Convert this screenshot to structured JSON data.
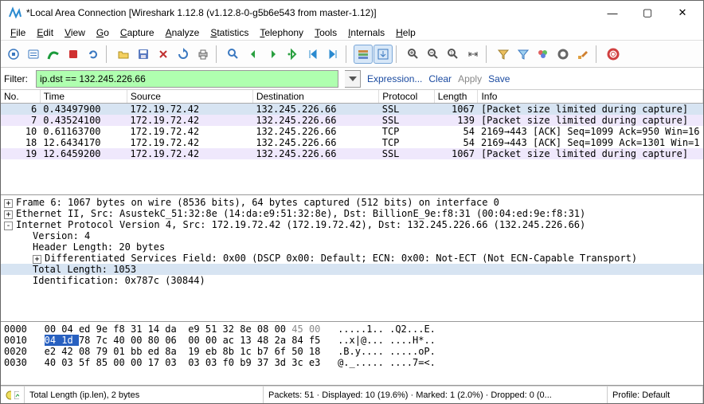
{
  "window": {
    "title": "*Local Area Connection   [Wireshark 1.12.8  (v1.12.8-0-g5b6e543 from master-1.12)]",
    "min": "—",
    "max": "▢",
    "close": "✕"
  },
  "menus": [
    "File",
    "Edit",
    "View",
    "Go",
    "Capture",
    "Analyze",
    "Statistics",
    "Telephony",
    "Tools",
    "Internals",
    "Help"
  ],
  "filter": {
    "label": "Filter:",
    "value": "ip.dst == 132.245.226.66",
    "links": {
      "expression": "Expression...",
      "clear": "Clear",
      "apply": "Apply",
      "save": "Save"
    }
  },
  "columns": [
    "No.",
    "Time",
    "Source",
    "Destination",
    "Protocol",
    "Length",
    "Info"
  ],
  "packets": [
    {
      "no": "6",
      "time": "0.43497900",
      "src": "172.19.72.42",
      "dst": "132.245.226.66",
      "proto": "SSL",
      "len": "1067",
      "info": "[Packet size limited during capture]",
      "sel": true
    },
    {
      "no": "7",
      "time": "0.43524100",
      "src": "172.19.72.42",
      "dst": "132.245.226.66",
      "proto": "SSL",
      "len": "139",
      "info": "[Packet size limited during capture]",
      "cls": "ssl"
    },
    {
      "no": "10",
      "time": "0.61163700",
      "src": "172.19.72.42",
      "dst": "132.245.226.66",
      "proto": "TCP",
      "len": "54",
      "info": "2169→443 [ACK] Seq=1099 Ack=950 Win=16"
    },
    {
      "no": "18",
      "time": "12.6434170",
      "src": "172.19.72.42",
      "dst": "132.245.226.66",
      "proto": "TCP",
      "len": "54",
      "info": "2169→443 [ACK] Seq=1099 Ack=1301 Win=1"
    },
    {
      "no": "19",
      "time": "12.6459200",
      "src": "172.19.72.42",
      "dst": "132.245.226.66",
      "proto": "SSL",
      "len": "1067",
      "info": "[Packet size limited during capture]",
      "cls": "ssl"
    }
  ],
  "tree": [
    {
      "exp": "+",
      "text": "Frame 6: 1067 bytes on wire (8536 bits), 64 bytes captured (512 bits) on interface 0"
    },
    {
      "exp": "+",
      "text": "Ethernet II, Src: AsustekC_51:32:8e (14:da:e9:51:32:8e), Dst: BillionE_9e:f8:31 (00:04:ed:9e:f8:31)"
    },
    {
      "exp": "-",
      "text": "Internet Protocol Version 4, Src: 172.19.72.42 (172.19.72.42), Dst: 132.245.226.66 (132.245.226.66)"
    },
    {
      "indent": 1,
      "text": "Version: 4"
    },
    {
      "indent": 1,
      "text": "Header Length: 20 bytes"
    },
    {
      "exp": "+",
      "indent": 1,
      "text": "Differentiated Services Field: 0x00 (DSCP 0x00: Default; ECN: 0x00: Not-ECT (Not ECN-Capable Transport)"
    },
    {
      "indent": 1,
      "text": "Total Length: 1053",
      "sel": true
    },
    {
      "indent": 1,
      "text": "Identification: 0x787c (30844)"
    }
  ],
  "hex": {
    "lines": [
      {
        "off": "0000",
        "b": "00 04 ed 9e f8 31 14 da  e9 51 32 8e 08 00 ",
        "g": "45 00",
        "a": ".....1.. .Q2...E."
      },
      {
        "off": "0010",
        "h": "04 1d ",
        "b": "78 7c 40 00 80 06  00 00 ac 13 48 2a 84 f5",
        "a": "..x|@... ....H*.."
      },
      {
        "off": "0020",
        "b": "e2 42 08 79 01 bb ed 8a  19 eb 8b 1c b7 6f 50 18",
        "a": ".B.y.... .....oP."
      },
      {
        "off": "0030",
        "b": "40 03 5f 85 00 00 17 03  03 03 f0 b9 37 3d 3c e3",
        "a": "@._..... ....7=<."
      }
    ]
  },
  "status": {
    "field": "Total Length (ip.len), 2 bytes",
    "packets": "Packets: 51 · Displayed: 10 (19.6%) · Marked: 1 (2.0%) · Dropped: 0 (0...",
    "profile": "Profile: Default"
  },
  "icons": {
    "shark": "#2a8ad0"
  }
}
